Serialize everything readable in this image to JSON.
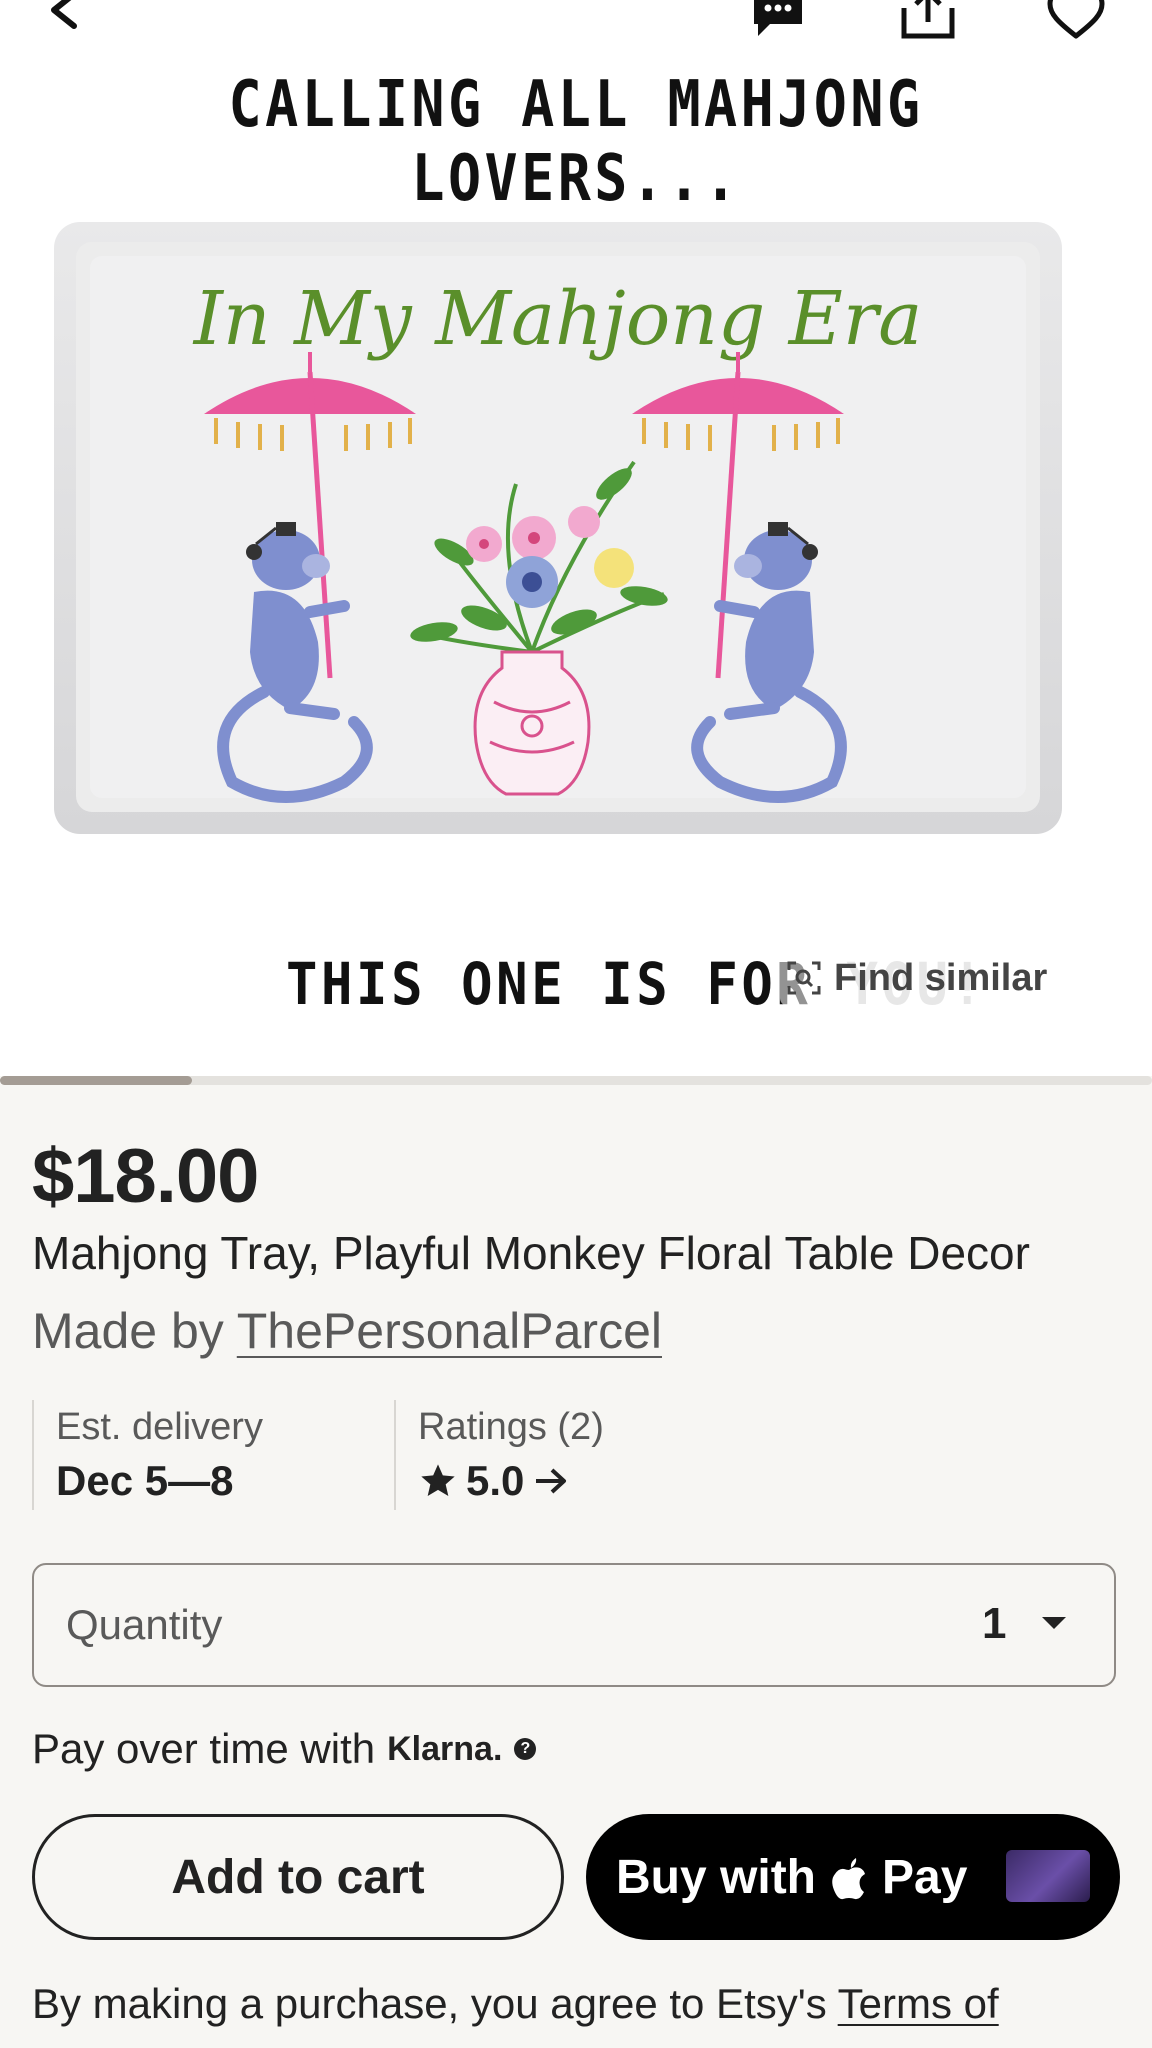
{
  "hero": {
    "headline": "CALLING ALL MAHJONG LOVERS...",
    "subheadline_main": "THIS ONE IS FOR",
    "subheadline_faded": "YOU!",
    "tray_text": "In My Mahjong Era",
    "find_similar_label": "Find similar",
    "carousel_progress_fraction": 0.167
  },
  "topbar": {
    "icons": [
      "back-icon",
      "messages-icon",
      "share-icon",
      "favorite-icon"
    ]
  },
  "listing": {
    "price": "$18.00",
    "title": "Mahjong Tray, Playful Monkey Floral Table Decor",
    "made_by_prefix": "Made by ",
    "shop_name": "ThePersonalParcel"
  },
  "info": {
    "delivery_label": "Est. delivery",
    "delivery_value": "Dec 5—8",
    "ratings_label": "Ratings (2)",
    "rating_value": "5.0"
  },
  "quantity": {
    "label": "Quantity",
    "value": "1"
  },
  "klarna": {
    "prefix": "Pay over time with",
    "brand": "Klarna."
  },
  "buttons": {
    "add_to_cart": "Add to cart",
    "buy_with": "Buy with",
    "pay": "Pay"
  },
  "legal": {
    "prefix": "By making a purchase, you agree to Etsy's ",
    "link": "Terms of"
  },
  "colors": {
    "accent_black": "#000000",
    "background": "#f7f6f3",
    "tray_text_green": "#5a8f2a",
    "umbrella_pink": "#e8579b",
    "monkey_blue": "#7f8fcf"
  }
}
